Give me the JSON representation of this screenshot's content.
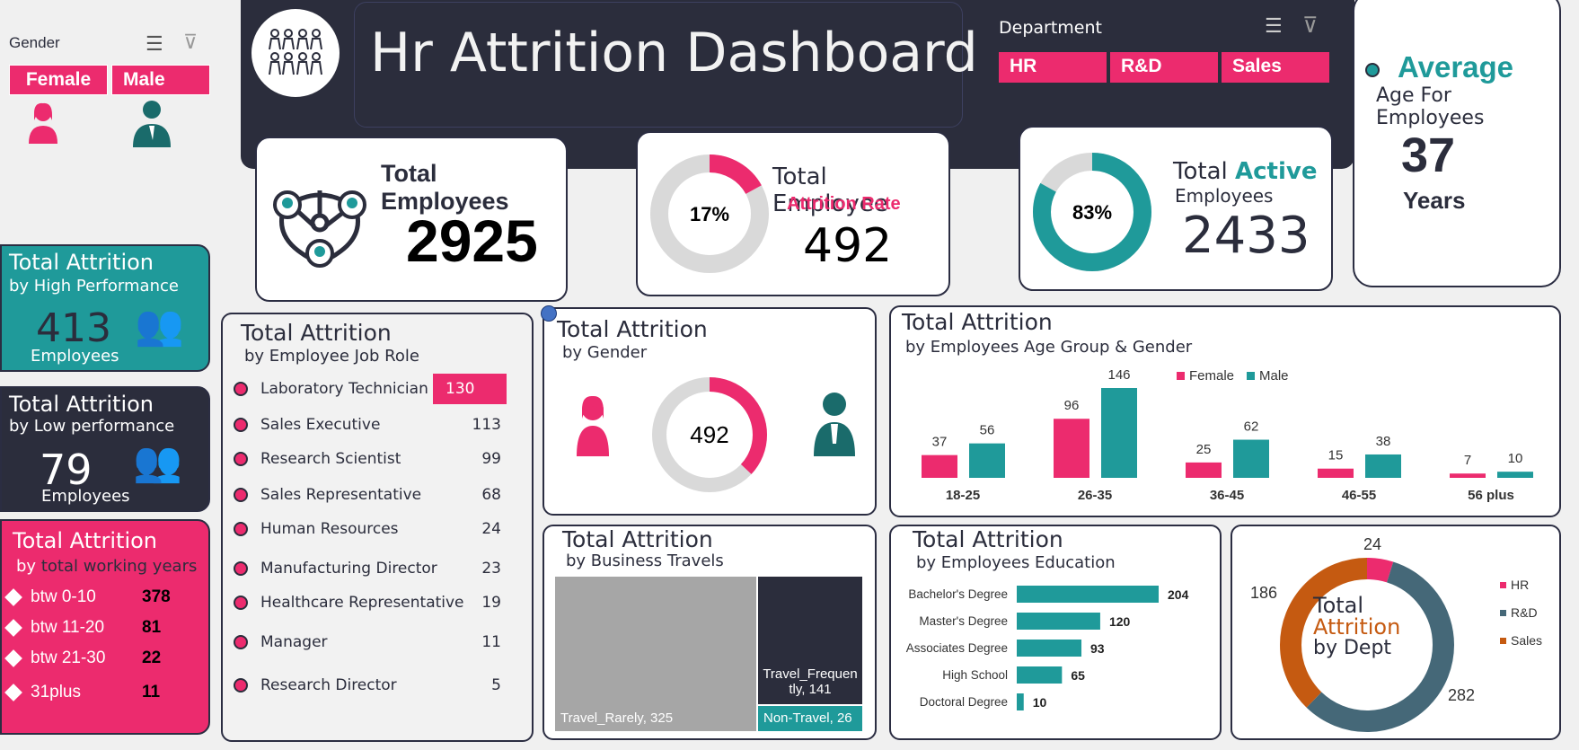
{
  "gender_slicer": {
    "title": "Gender",
    "items": [
      "Female",
      "Male"
    ]
  },
  "dept_slicer": {
    "title": "Department",
    "items": [
      "HR",
      "R&D",
      "Sales"
    ]
  },
  "header": {
    "title": "Hr Attrition Dashboard"
  },
  "avg_age": {
    "title": "Average",
    "subtitle": "Age For Employees",
    "value": "37",
    "unit": "Years"
  },
  "total_employees": {
    "label": "Total Employees",
    "value": "2925"
  },
  "attrition_rate": {
    "pct": "17%",
    "pct_value": 17,
    "label1": "Total Employee",
    "label2": "Attrition Rate",
    "value": "492"
  },
  "active": {
    "pct": "83%",
    "pct_value": 83,
    "label1": "Total ",
    "label1b": "Active",
    "label2": "Employees",
    "value": "2433"
  },
  "high_perf": {
    "title": "Total Attrition",
    "subtitle": "by High Performance",
    "value": "413",
    "unit": "Employees"
  },
  "low_perf": {
    "title": "Total Attrition",
    "subtitle": "by Low performance",
    "value": "79",
    "unit": "Employees"
  },
  "working_years": {
    "title": "Total Attrition",
    "subtitle_a": "by ",
    "subtitle_b": "total working years",
    "rows": [
      {
        "label": "btw 0-10",
        "value": "378"
      },
      {
        "label": "btw 11-20",
        "value": "81"
      },
      {
        "label": "btw 21-30",
        "value": "22"
      },
      {
        "label": "31plus",
        "value": "11"
      }
    ]
  },
  "job_role": {
    "title": "Total Attrition",
    "subtitle": "by Employee Job Role",
    "rows": [
      {
        "label": "Laboratory Technician",
        "value": "130"
      },
      {
        "label": "Sales Executive",
        "value": "113"
      },
      {
        "label": "Research Scientist",
        "value": "99"
      },
      {
        "label": "Sales Representative",
        "value": "68"
      },
      {
        "label": "Human Resources",
        "value": "24"
      },
      {
        "label": "Manufacturing Director",
        "value": "23"
      },
      {
        "label": "Healthcare Representative",
        "value": "19"
      },
      {
        "label": "Manager",
        "value": "11"
      },
      {
        "label": "Research Director",
        "value": "5"
      }
    ]
  },
  "by_gender": {
    "title": "Total Attrition",
    "subtitle": "by Gender",
    "value": "492"
  },
  "age_group": {
    "title": "Total Attrition",
    "subtitle": "by Employees Age Group & Gender"
  },
  "business_travel": {
    "title": "Total Attrition",
    "subtitle": "by Business Travels",
    "items": [
      {
        "label": "Travel_Rarely, 325",
        "value": 325
      },
      {
        "label": "Travel_Frequently, 141",
        "value": 141
      },
      {
        "label": "Non-Travel, 26",
        "value": 26
      }
    ]
  },
  "education": {
    "title": "Total Attrition",
    "subtitle": "by Employees Education"
  },
  "dept": {
    "title1": "Total",
    "title2": "Attrition",
    "title3": "by Dept"
  },
  "colors": {
    "pink": "#ec2b6e",
    "teal": "#1f9a9a",
    "dark": "#2b2d3c",
    "slate": "#456878",
    "orange": "#c55a11",
    "grey": "#a6a6a6"
  },
  "chart_data": [
    {
      "type": "bar",
      "title": "Total Attrition by Employees Age Group & Gender",
      "categories": [
        "18-25",
        "26-35",
        "36-45",
        "46-55",
        "56 plus"
      ],
      "series": [
        {
          "name": "Female",
          "values": [
            37,
            96,
            25,
            15,
            7
          ]
        },
        {
          "name": "Male",
          "values": [
            56,
            146,
            62,
            38,
            10
          ]
        }
      ],
      "legend": "top"
    },
    {
      "type": "bar",
      "orientation": "horizontal",
      "title": "Total Attrition by Employees Education",
      "categories": [
        "Bachelor's Degree",
        "Master's Degree",
        "Associates Degree",
        "High School",
        "Doctoral Degree"
      ],
      "values": [
        204,
        120,
        93,
        65,
        10
      ]
    },
    {
      "type": "pie",
      "donut": true,
      "title": "Total Attrition by Dept",
      "categories": [
        "HR",
        "R&D",
        "Sales"
      ],
      "values": [
        24,
        282,
        186
      ],
      "legend": "right"
    },
    {
      "type": "pie",
      "donut": true,
      "title": "Total Attrition by Gender",
      "categories": [
        "Female",
        "Male"
      ],
      "values": [
        0.37,
        0.63
      ]
    }
  ]
}
